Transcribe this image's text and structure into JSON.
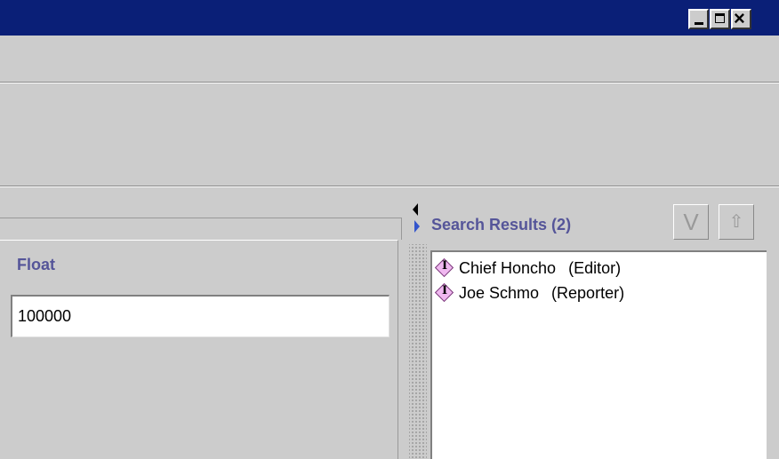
{
  "window": {
    "controls": {
      "minimize_icon": "minimize-icon",
      "maximize_icon": "maximize-icon",
      "close_icon": "close-icon",
      "close_glyph": "×"
    },
    "title_bar_color": "#0a1f77"
  },
  "left_panel": {
    "field_label": "Float",
    "field_value": "100000"
  },
  "splitter": {
    "collapse_left_icon": "arrow-left-icon",
    "expand_right_icon": "arrow-right-icon"
  },
  "search_results": {
    "title": "Search Results (2)",
    "toolbar": {
      "v_button_label": "V",
      "up_button_glyph": "⇧"
    },
    "items": [
      {
        "icon": "info-diamond-icon",
        "icon_letter": "I",
        "name": "Chief Honcho",
        "role": "(Editor)"
      },
      {
        "icon": "info-diamond-icon",
        "icon_letter": "I",
        "name": "Joe Schmo",
        "role": "(Reporter)"
      }
    ]
  },
  "colors": {
    "label_color": "#555599",
    "background": "#cccccc"
  }
}
